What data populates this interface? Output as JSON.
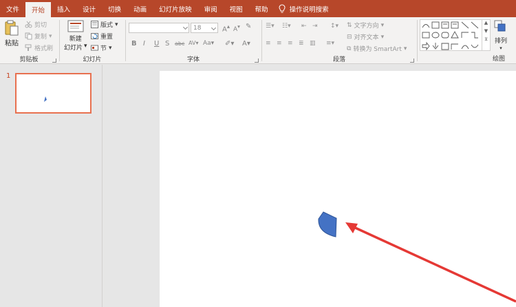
{
  "menubar": {
    "items": [
      "文件",
      "开始",
      "插入",
      "设计",
      "切换",
      "动画",
      "幻灯片放映",
      "审阅",
      "视图",
      "帮助"
    ],
    "active_index": 1,
    "tell_me": "操作说明搜索"
  },
  "ribbon": {
    "clipboard": {
      "label": "剪贴板",
      "paste": "粘贴",
      "cut": "剪切",
      "copy": "复制",
      "format_painter": "格式刷"
    },
    "slides": {
      "label": "幻灯片",
      "new_slide_line1": "新建",
      "new_slide_line2": "幻灯片",
      "layout": "版式",
      "reset": "重置",
      "section": "节"
    },
    "font": {
      "label": "字体",
      "font_name": "",
      "font_size": "18",
      "bold": "B",
      "italic": "I",
      "underline": "U",
      "shadow": "S",
      "strike": "abc",
      "spacing": "AV",
      "case": "Aa",
      "grow": "A",
      "shrink": "A",
      "color": "A"
    },
    "paragraph": {
      "label": "段落",
      "text_direction": "文字方向",
      "align_text": "对齐文本",
      "convert_smartart": "转换为 SmartArt"
    },
    "drawing": {
      "label": "绘图",
      "arrange": "排列"
    }
  },
  "thumbnails": {
    "slide_number": "1"
  },
  "colors": {
    "accent": "#b7472a",
    "thumb_border": "#e8704f",
    "shape_fill": "#4472c4",
    "arrow": "#e53935"
  }
}
